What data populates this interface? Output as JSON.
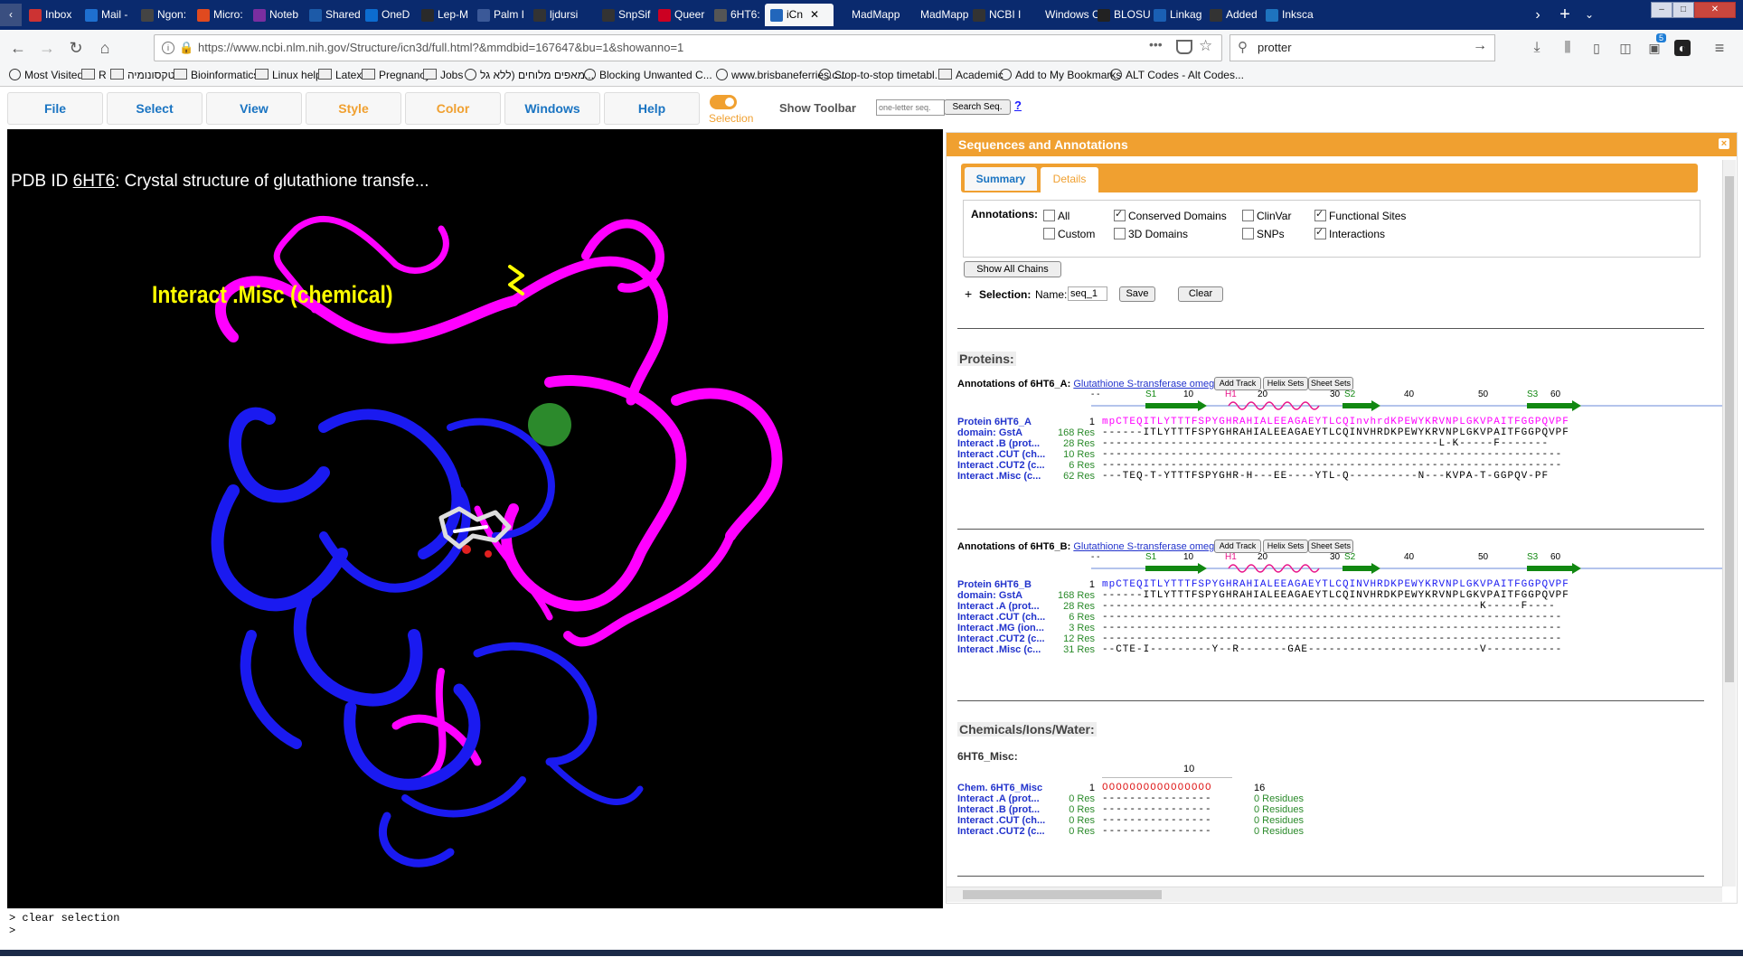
{
  "browser": {
    "tabs": [
      {
        "label": "Inbox",
        "color": "#c33"
      },
      {
        "label": "Mail -",
        "color": "#1e6fd0"
      },
      {
        "label": "Ngon:",
        "color": "#444"
      },
      {
        "label": "Micro:",
        "color": "#e04a1f"
      },
      {
        "label": "Noteb",
        "color": "#7a2ea0"
      },
      {
        "label": "Shared",
        "color": "#1c5aa8"
      },
      {
        "label": "OneD",
        "color": "#0c6cd0"
      },
      {
        "label": "Lep-M",
        "color": "#2a2a2a"
      },
      {
        "label": "Palm I",
        "color": "#3b5998"
      },
      {
        "label": "ljdursi",
        "color": "#333"
      },
      {
        "label": "SnpSif",
        "color": "#333"
      },
      {
        "label": "Queer",
        "color": "#c02"
      },
      {
        "label": "6HT6:",
        "color": "#555"
      },
      {
        "label": "iCn",
        "color": "#2266bb",
        "active": true
      },
      {
        "label": "MadMapp",
        "color": ""
      },
      {
        "label": "MadMapp",
        "color": ""
      },
      {
        "label": "NCBI I",
        "color": "#333"
      },
      {
        "label": "Windows C",
        "color": ""
      },
      {
        "label": "BLOSU",
        "color": "#222"
      },
      {
        "label": "Linkag",
        "color": "#1a5fb4"
      },
      {
        "label": "Added",
        "color": "#333"
      },
      {
        "label": "Inksca",
        "color": "#1e73be"
      }
    ],
    "url": "https://www.ncbi.nlm.nih.gov/Structure/icn3d/full.html?&mmdbid=167647&bu=1&showanno=1",
    "search_value": "protter",
    "download_badge": "5",
    "bookmarks": [
      {
        "label": "Most Visited",
        "icon": "gear"
      },
      {
        "label": "R",
        "icon": "folder"
      },
      {
        "label": "טקסונומיה",
        "icon": "folder"
      },
      {
        "label": "Bioinformatics",
        "icon": "folder"
      },
      {
        "label": "Linux help",
        "icon": "folder"
      },
      {
        "label": "Latex",
        "icon": "folder"
      },
      {
        "label": "Pregnancy",
        "icon": "folder"
      },
      {
        "label": "Jobs",
        "icon": "folder"
      },
      {
        "label": "מאפים מלוחים (ללא גל...",
        "icon": "globe"
      },
      {
        "label": "Blocking Unwanted C...",
        "icon": "globe"
      },
      {
        "label": "www.brisbaneferries.c...",
        "icon": "globe"
      },
      {
        "label": "Stop-to-stop timetabl...",
        "icon": "globe"
      },
      {
        "label": "Academic",
        "icon": "folder"
      },
      {
        "label": "Add to My Bookmarks",
        "icon": "globe"
      },
      {
        "label": "ALT Codes - Alt Codes...",
        "icon": "globe"
      }
    ]
  },
  "menu": {
    "items": [
      "File",
      "Select",
      "View",
      "Style",
      "Color",
      "Windows",
      "Help"
    ],
    "selection_label": "Selection",
    "show_toolbar": "Show Toolbar",
    "seq_placeholder": "one-letter seq.",
    "search_seq": "Search Seq.",
    "help_q": "?"
  },
  "viewer": {
    "title_prefix": "PDB ID ",
    "pdb_link": "6HT6",
    "title_suffix": ": Crystal structure of glutathione transfe...",
    "hover_label": "Interact .Misc (chemical)"
  },
  "console": {
    "line1": "> clear selection",
    "line2": ">"
  },
  "panel": {
    "title": "Sequences and Annotations",
    "close": "×",
    "tabs": [
      "Summary",
      "Details"
    ],
    "annotations_label": "Annotations:",
    "checkboxes": [
      {
        "label": "All",
        "checked": false
      },
      {
        "label": "Conserved Domains",
        "checked": true
      },
      {
        "label": "ClinVar",
        "checked": false
      },
      {
        "label": "Functional Sites",
        "checked": true
      },
      {
        "label": "Custom",
        "checked": false
      },
      {
        "label": "3D Domains",
        "checked": false
      },
      {
        "label": "SNPs",
        "checked": false
      },
      {
        "label": "Interactions",
        "checked": true
      }
    ],
    "show_all_chains": "Show All Chains",
    "plus": "+",
    "selection_label": "Selection:",
    "name_label": "Name:",
    "name_value": "seq_1",
    "save": "Save",
    "clear": "Clear",
    "proteins_heading": "Proteins:",
    "chain_buttons": [
      "Add Track",
      "Helix Sets",
      "Sheet Sets"
    ],
    "ruler": {
      "dashes": "- -",
      "s1": "S1",
      "n10": "10",
      "h1": "H1",
      "n20": "20",
      "n30": "30",
      "s2": "S2",
      "n40": "40",
      "n50": "50",
      "s3": "S3",
      "n60": "60"
    },
    "chainA": {
      "prefix": "Annotations of 6HT6_A: ",
      "link": "Glutathione S-transferase omega 2S",
      "rows": [
        {
          "name": "Protein 6HT6_A",
          "count": "1",
          "seq": "mpCTEQITLYTTTFSPYGHRAHIALEEAGAEYTLCQInvhrdKPEWYKRVNPLGKVPAITFGGPQVPF"
        },
        {
          "name": "domain: GstA",
          "count": "168 Res",
          "seq": "------ITLYTTTFSPYGHRAHIALEEAGAEYTLCQINVHRDKPEWYKRVNPLGKVPAITFGGPQVPF"
        },
        {
          "name": "Interact .B (prot...",
          "count": "28 Res",
          "seq": "-------------------------------------------------L-K-----F-------"
        },
        {
          "name": "Interact .CUT (ch...",
          "count": "10 Res",
          "seq": "-------------------------------------------------------------------"
        },
        {
          "name": "Interact .CUT2 (c...",
          "count": "6 Res",
          "seq": "-------------------------------------------------------------------"
        },
        {
          "name": "Interact .Misc (c...",
          "count": "62 Res",
          "seq": "---TEQ-T-YTTTFSPYGHR-H---EE----YTL-Q----------N---KVPA-T-GGPQV-PF"
        }
      ]
    },
    "chainB": {
      "prefix": "Annotations of 6HT6_B: ",
      "link": "Glutathione S-transferase omega 2S",
      "rows": [
        {
          "name": "Protein 6HT6_B",
          "count": "1",
          "seq": "mpCTEQITLYTTTFSPYGHRAHIALEEAGAEYTLCQINVHRDKPEWYKRVNPLGKVPAITFGGPQVPF"
        },
        {
          "name": "domain: GstA",
          "count": "168 Res",
          "seq": "------ITLYTTTFSPYGHRAHIALEEAGAEYTLCQINVHRDKPEWYKRVNPLGKVPAITFGGPQVPF"
        },
        {
          "name": "Interact .A (prot...",
          "count": "28 Res",
          "seq": "-------------------------------------------------------K-----F----"
        },
        {
          "name": "Interact .CUT (ch...",
          "count": "6 Res",
          "seq": "-------------------------------------------------------------------"
        },
        {
          "name": "Interact .MG (ion...",
          "count": "3 Res",
          "seq": "-------------------------------------------------------------------"
        },
        {
          "name": "Interact .CUT2 (c...",
          "count": "12 Res",
          "seq": "-------------------------------------------------------------------"
        },
        {
          "name": "Interact .Misc (c...",
          "count": "31 Res",
          "seq": "--CTE-I---------Y--R-------GAE-------------------------V-----------"
        }
      ]
    },
    "chemicals_heading": "Chemicals/Ions/Water:",
    "chem_label": "6HT6_Misc:",
    "chem_ruler": "10",
    "chem_rows": [
      {
        "name": "Chem. 6HT6_Misc",
        "count": "1",
        "seq": "OOOOOOOOOOOOOOOO",
        "end": "16"
      },
      {
        "name": "Interact .A (prot...",
        "count": "0 Res",
        "seq": "----------------",
        "end": "0 Residues"
      },
      {
        "name": "Interact .B (prot...",
        "count": "0 Res",
        "seq": "----------------",
        "end": "0 Residues"
      },
      {
        "name": "Interact .CUT (ch...",
        "count": "0 Res",
        "seq": "----------------",
        "end": "0 Residues"
      },
      {
        "name": "Interact .CUT2 (c...",
        "count": "0 Res",
        "seq": "----------------",
        "end": "0 Residues"
      }
    ]
  },
  "colors": {
    "accent": "#f0a030",
    "link": "#1a74c2",
    "chainA": "#ff00ff",
    "chainB": "#1a1af0",
    "helix": "#e8158a",
    "strand": "#118811"
  }
}
